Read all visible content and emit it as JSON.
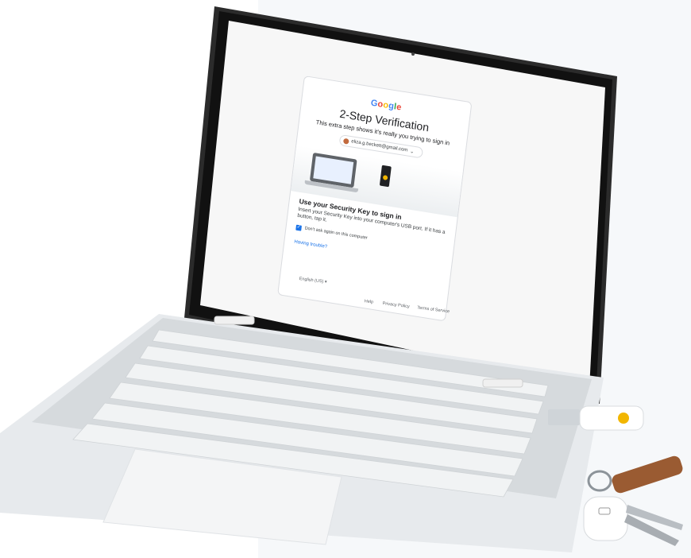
{
  "brand": {
    "letters": [
      "G",
      "o",
      "o",
      "g",
      "l",
      "e"
    ]
  },
  "auth": {
    "title": "2-Step Verification",
    "subtitle": "This extra step shows it's really you trying to sign in",
    "account_email": "eliza.g.beckett@gmail.com",
    "heading": "Use your Security Key to sign in",
    "instructions": "Insert your Security Key into your computer's USB port. If it has a button, tap it.",
    "dont_ask_label": "Don't ask again on this computer",
    "dont_ask_checked": true,
    "trouble_link": "Having trouble?"
  },
  "footer": {
    "language": "English (US) ▾",
    "help": "Help",
    "privacy": "Privacy Policy",
    "terms": "Terms of Service"
  },
  "colors": {
    "google_blue": "#4285F4",
    "google_red": "#EA4335",
    "google_yellow": "#FBBC05",
    "google_green": "#34A853",
    "link_blue": "#1a73e8",
    "security_key_gold": "#f2b600"
  }
}
